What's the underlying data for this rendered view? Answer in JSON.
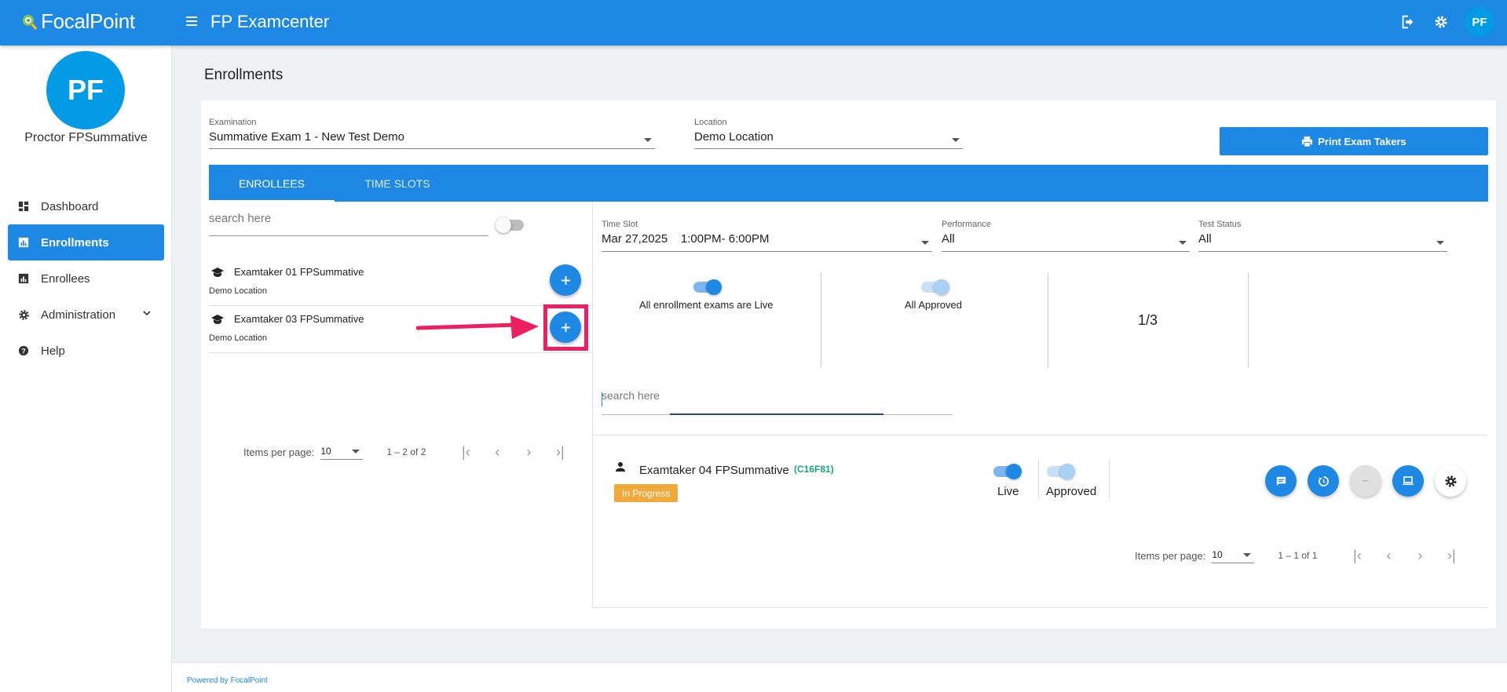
{
  "brand": {
    "name": "FocalPoint"
  },
  "header": {
    "title": "FP Examcenter",
    "avatar_initials": "PF"
  },
  "sidebar": {
    "avatar_initials": "PF",
    "user_name": "Proctor FPSummative",
    "items": [
      {
        "label": "Dashboard",
        "icon": "dashboard-icon"
      },
      {
        "label": "Enrollments",
        "icon": "bar-chart-icon",
        "active": true
      },
      {
        "label": "Enrollees",
        "icon": "bar-chart-icon"
      },
      {
        "label": "Administration",
        "icon": "gear-icon",
        "expandable": true
      },
      {
        "label": "Help",
        "icon": "help-icon"
      }
    ]
  },
  "page": {
    "title": "Enrollments"
  },
  "filters": {
    "examination": {
      "label": "Examination",
      "value": "Summative Exam 1 - New Test Demo"
    },
    "location": {
      "label": "Location",
      "value": "Demo Location"
    }
  },
  "print_button": {
    "label": "Print Exam Takers"
  },
  "tabs": [
    {
      "label": "ENROLLEES",
      "active": true
    },
    {
      "label": "TIME SLOTS",
      "active": false
    }
  ],
  "left_pane": {
    "search_placeholder": "search here",
    "enrollees": [
      {
        "name": "Examtaker 01 FPSummative",
        "location": "Demo Location"
      },
      {
        "name": "Examtaker 03 FPSummative",
        "location": "Demo Location"
      }
    ],
    "pager": {
      "items_per_page_label": "Items per page:",
      "page_size": "10",
      "range": "1 – 2 of 2"
    }
  },
  "right_pane": {
    "time_slot": {
      "label": "Time Slot",
      "value": "Mar 27,2025    1:00PM- 6:00PM"
    },
    "performance": {
      "label": "Performance",
      "value": "All"
    },
    "test_status": {
      "label": "Test Status",
      "value": "All"
    },
    "stats": {
      "live_label": "All enrollment exams are Live",
      "approved_label": "All Approved",
      "ratio": "1/3"
    },
    "search_placeholder": "search here",
    "taker": {
      "name": "Examtaker 04 FPSummative",
      "code": "(C16F81)",
      "status": "In Progress",
      "live_label": "Live",
      "approved_label": "Approved"
    },
    "pager": {
      "items_per_page_label": "Items per page:",
      "page_size": "10",
      "range": "1 – 1 of 1"
    }
  },
  "footer": {
    "text": "Powered by FocalPoint"
  },
  "colors": {
    "primary": "#1e88e5",
    "highlight": "#ec1f61",
    "badge": "#f0a93b",
    "code": "#1aa774"
  }
}
